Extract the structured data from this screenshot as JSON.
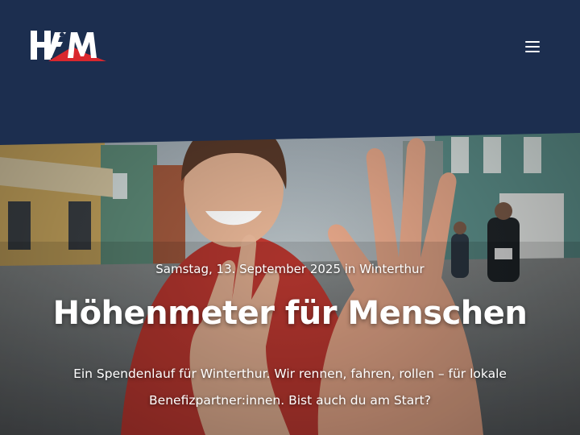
{
  "brand": {
    "logo_alt": "HFM"
  },
  "nav": {
    "menu_icon": "hamburger-icon"
  },
  "hero": {
    "date_line": "Samstag, 13. September 2025 in Winterthur",
    "title": "Höhenmeter für Menschen",
    "lead": "Ein Spendenlauf für Winterthur. Wir rennen, fahren, rollen – für lokale Benefizpartner:innen. Bist auch du am Start?"
  },
  "colors": {
    "navy": "#1c2e4f",
    "accent_red": "#d9272e",
    "text": "#ffffff"
  }
}
